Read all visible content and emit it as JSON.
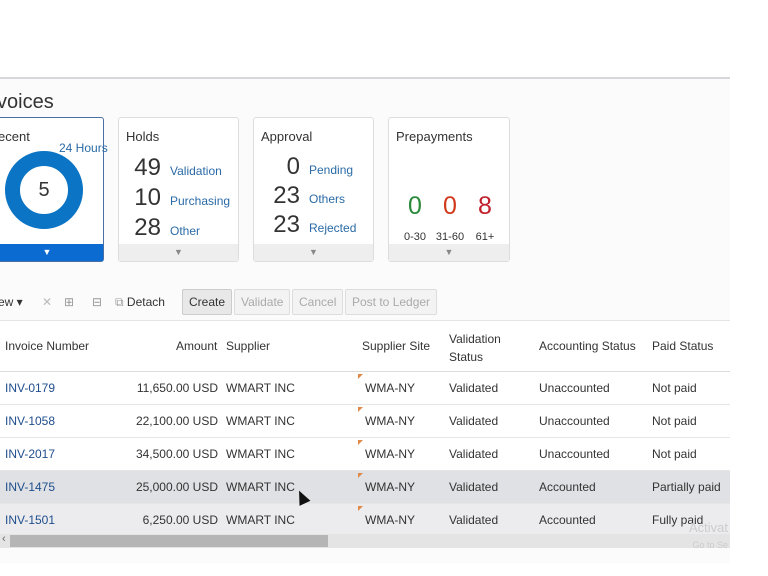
{
  "page": {
    "title": "voices"
  },
  "tiles": {
    "recent": {
      "title": "ecent",
      "period": "24 Hours",
      "count": "5"
    },
    "holds": {
      "title": "Holds",
      "items": [
        {
          "n": "49",
          "l": "Validation"
        },
        {
          "n": "10",
          "l": "Purchasing"
        },
        {
          "n": "28",
          "l": "Other"
        }
      ]
    },
    "approval": {
      "title": "Approval",
      "items": [
        {
          "n": "0",
          "l": "Pending"
        },
        {
          "n": "23",
          "l": "Others"
        },
        {
          "n": "23",
          "l": "Rejected"
        }
      ]
    },
    "prepayments": {
      "title": "Prepayments",
      "items": [
        {
          "n": "0",
          "l": "0-30",
          "color": "#2a8a3a"
        },
        {
          "n": "0",
          "l": "31-60",
          "color": "#d03a1a"
        },
        {
          "n": "8",
          "l": "61+",
          "color": "#c0202a"
        }
      ]
    }
  },
  "toolbar": {
    "view": "ew ▾",
    "detach": "Detach",
    "create": "Create",
    "validate": "Validate",
    "cancel": "Cancel",
    "post": "Post to Ledger"
  },
  "table": {
    "headers": [
      "Invoice Number",
      "Amount",
      "Supplier",
      "Supplier Site",
      "Validation Status",
      "Accounting Status",
      "Paid Status"
    ],
    "rows": [
      [
        "INV-0179",
        "11,650.00 USD",
        "WMART INC",
        "WMA-NY",
        "Validated",
        "Unaccounted",
        "Not paid"
      ],
      [
        "INV-1058",
        "22,100.00 USD",
        "WMART INC",
        "WMA-NY",
        "Validated",
        "Unaccounted",
        "Not paid"
      ],
      [
        "INV-2017",
        "34,500.00 USD",
        "WMART INC",
        "WMA-NY",
        "Validated",
        "Unaccounted",
        "Not paid"
      ],
      [
        "INV-1475",
        "25,000.00 USD",
        "WMART INC",
        "WMA-NY",
        "Validated",
        "Accounted",
        "Partially paid"
      ],
      [
        "INV-1501",
        "6,250.00 USD",
        "WMART INC",
        "WMA-NY",
        "Validated",
        "Accounted",
        "Fully paid"
      ]
    ]
  },
  "watermark": {
    "line1": "Activat",
    "line2": "Go to Se"
  }
}
